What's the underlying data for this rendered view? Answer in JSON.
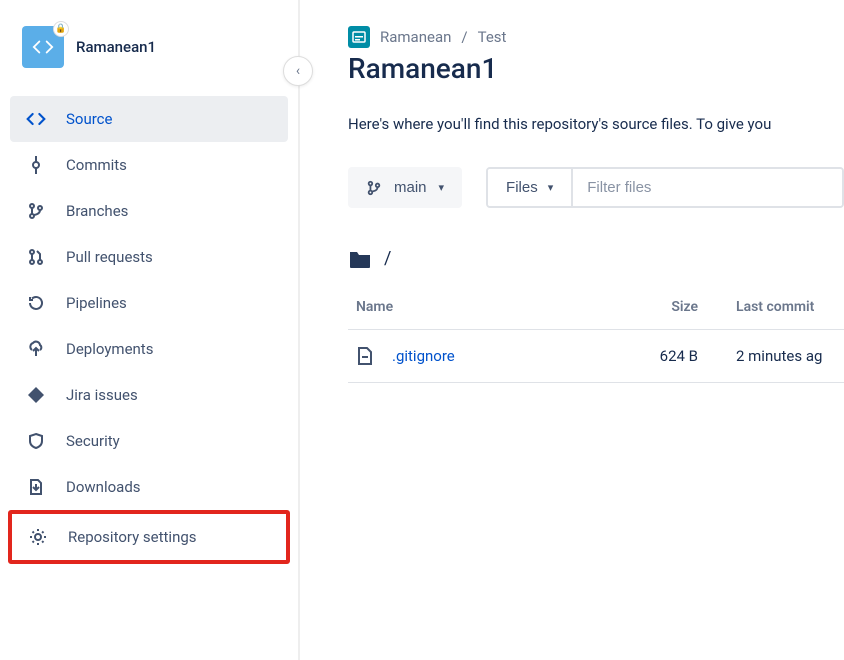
{
  "sidebar": {
    "repo_name": "Ramanean1",
    "items": [
      {
        "key": "source",
        "label": "Source"
      },
      {
        "key": "commits",
        "label": "Commits"
      },
      {
        "key": "branches",
        "label": "Branches"
      },
      {
        "key": "pulls",
        "label": "Pull requests"
      },
      {
        "key": "pipelines",
        "label": "Pipelines"
      },
      {
        "key": "deployments",
        "label": "Deployments"
      },
      {
        "key": "jira",
        "label": "Jira issues"
      },
      {
        "key": "security",
        "label": "Security"
      },
      {
        "key": "downloads",
        "label": "Downloads"
      },
      {
        "key": "settings",
        "label": "Repository settings"
      }
    ]
  },
  "breadcrumb": {
    "workspace": "Ramanean",
    "project": "Test"
  },
  "page": {
    "title": "Ramanean1",
    "intro": "Here's where you'll find this repository's source files. To give you"
  },
  "toolbar": {
    "branch": "main",
    "files_label": "Files",
    "filter_placeholder": "Filter files"
  },
  "path": "/",
  "table": {
    "headers": {
      "name": "Name",
      "size": "Size",
      "last": "Last commit"
    },
    "rows": [
      {
        "name": ".gitignore",
        "size": "624 B",
        "last": "2 minutes ag"
      }
    ]
  }
}
